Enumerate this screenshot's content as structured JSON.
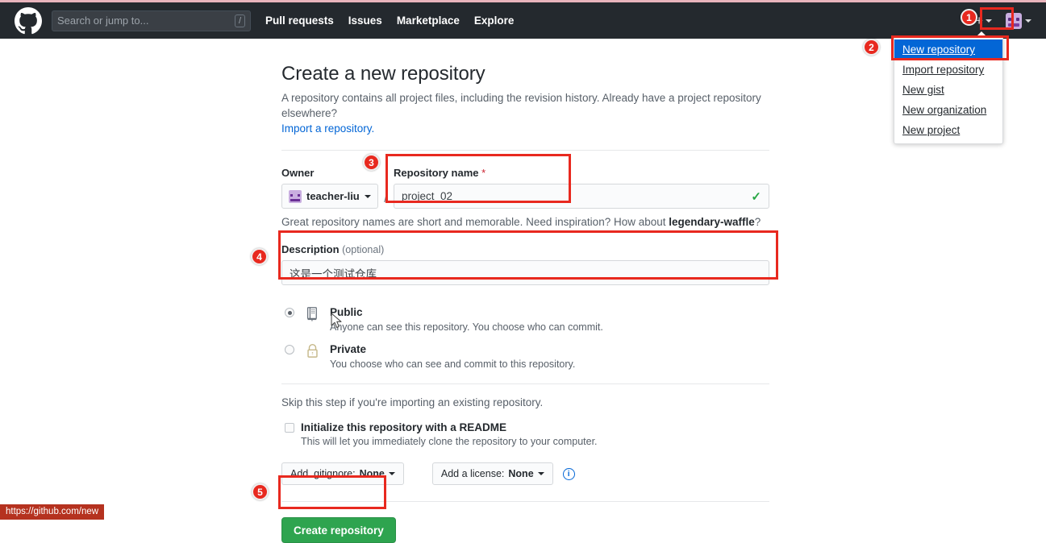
{
  "header": {
    "logo_icon": "github-logo-icon",
    "search": {
      "placeholder": "Search or jump to...",
      "shortcut_key": "/"
    },
    "nav": [
      {
        "label": "Pull requests"
      },
      {
        "label": "Issues"
      },
      {
        "label": "Marketplace"
      },
      {
        "label": "Explore"
      }
    ],
    "plus_icon": "plus-icon",
    "caret_icon": "chevron-down-icon",
    "avatar_icon": "user-avatar-icon",
    "bar_color": "#24292e"
  },
  "dropdown": {
    "items": [
      {
        "label": "New repository",
        "selected": true
      },
      {
        "label": "Import repository",
        "selected": false
      },
      {
        "label": "New gist",
        "selected": false
      },
      {
        "label": "New organization",
        "selected": false
      },
      {
        "label": "New project",
        "selected": false
      }
    ],
    "highlight_color": "#0366d6"
  },
  "main": {
    "title": "Create a new repository",
    "lede": "A repository contains all project files, including the revision history. Already have a project repository elsewhere?",
    "import_link": "Import a repository.",
    "owner": {
      "label": "Owner",
      "value": "teacher-liu",
      "avatar_icon": "owner-avatar-icon",
      "caret_icon": "chevron-down-icon",
      "separator": "/"
    },
    "repo_name": {
      "label": "Repository name",
      "required_marker": "*",
      "value": "project_02",
      "valid_icon": "check-icon"
    },
    "name_helper_prefix": "Great repository names are short and memorable. Need inspiration? How about ",
    "name_helper_suggestion": "legendary-waffle",
    "name_helper_suffix": "?",
    "description": {
      "label": "Description",
      "optional": "(optional)",
      "value": "这是一个测试仓库"
    },
    "visibility": [
      {
        "id": "public",
        "icon": "book-icon",
        "title": "Public",
        "desc": "Anyone can see this repository. You choose who can commit.",
        "selected": true
      },
      {
        "id": "private",
        "icon": "lock-icon",
        "title": "Private",
        "desc": "You choose who can see and commit to this repository.",
        "selected": false
      }
    ],
    "skip_line": "Skip this step if you're importing an existing repository.",
    "readme": {
      "title": "Initialize this repository with a README",
      "desc": "This will let you immediately clone the repository to your computer.",
      "checked": false
    },
    "gitignore": {
      "prefix": "Add .gitignore: ",
      "value": "None",
      "caret_icon": "chevron-down-icon"
    },
    "license": {
      "prefix": "Add a license: ",
      "value": "None",
      "caret_icon": "chevron-down-icon"
    },
    "info_icon": "info-icon",
    "create_button": "Create repository",
    "create_button_color": "#2ea44f"
  },
  "annotations": {
    "color": "#e8291f",
    "badges": [
      {
        "n": "1"
      },
      {
        "n": "2"
      },
      {
        "n": "3"
      },
      {
        "n": "4"
      },
      {
        "n": "5"
      }
    ]
  },
  "statusbar": {
    "url": "https://github.com/new"
  }
}
